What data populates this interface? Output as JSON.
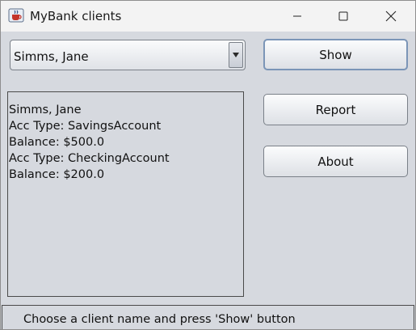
{
  "window": {
    "title": "MyBank clients",
    "icon": "java-coffee-cup-icon",
    "controls": [
      "minimize-icon",
      "maximize-icon",
      "close-icon"
    ]
  },
  "client_select": {
    "selected": "Simms, Jane",
    "arrow_icon": "triangle-down-icon"
  },
  "buttons": {
    "show": "Show",
    "report": "Report",
    "about": "About"
  },
  "details": {
    "lines": [
      "Simms, Jane",
      "Acc Type: SavingsAccount",
      "Balance: $500.0",
      "Acc Type: CheckingAccount",
      "Balance: $200.0"
    ]
  },
  "status": {
    "text": "Choose a client name and press 'Show' button"
  }
}
